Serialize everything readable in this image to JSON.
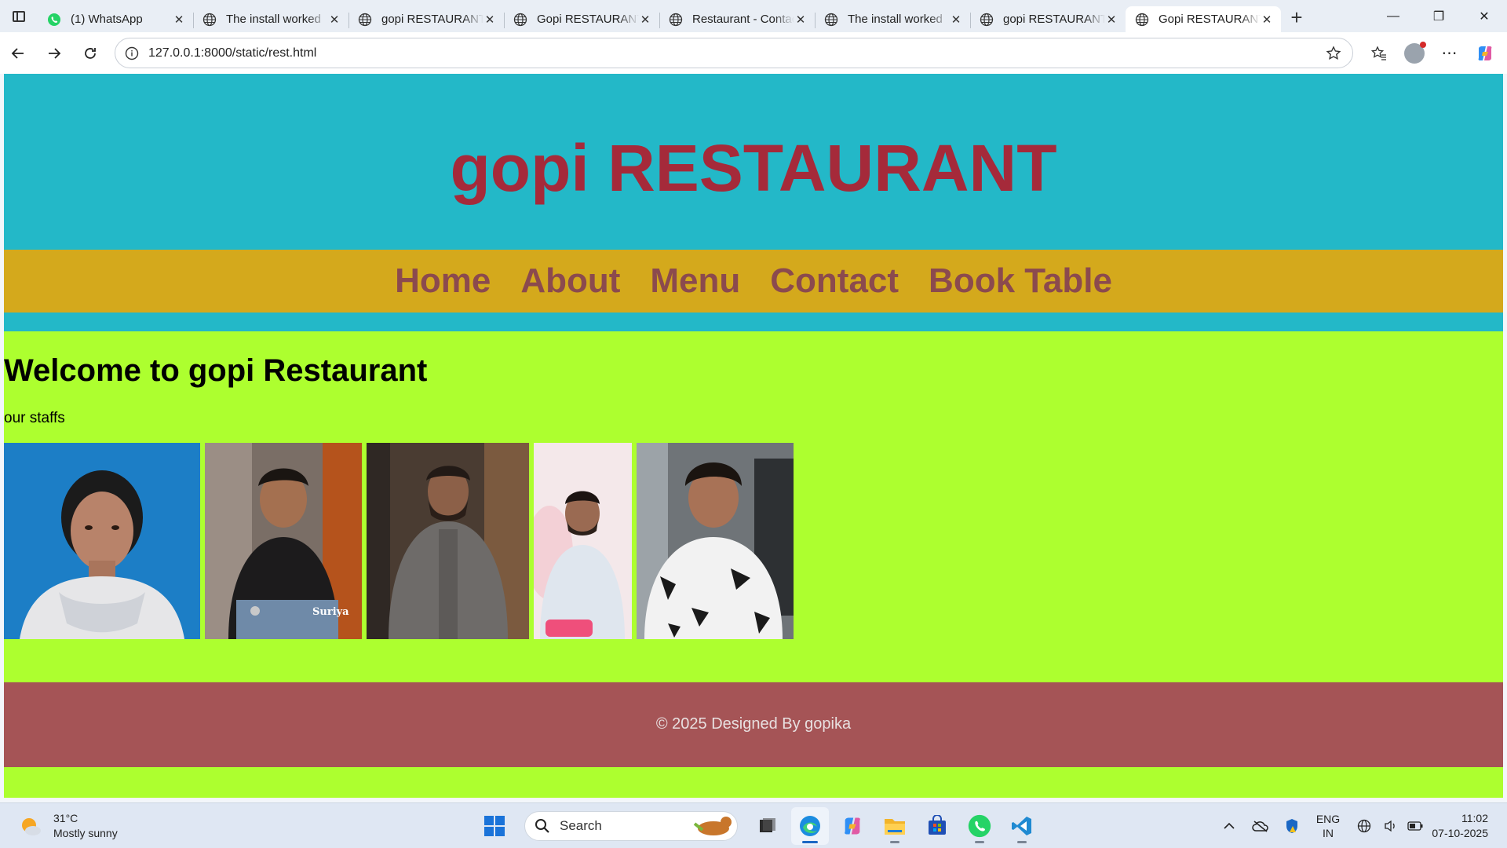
{
  "browser": {
    "tabs": [
      {
        "title": "(1) WhatsApp",
        "icon": "whatsapp-icon",
        "active": false
      },
      {
        "title": "The install worked",
        "icon": "globe-icon",
        "active": false
      },
      {
        "title": "gopi RESTAURANT",
        "icon": "globe-icon",
        "active": false
      },
      {
        "title": "Gopi RESTAURANT",
        "icon": "globe-icon",
        "active": false
      },
      {
        "title": "Restaurant - Contact",
        "icon": "globe-icon",
        "active": false
      },
      {
        "title": "The install worked",
        "icon": "globe-icon",
        "active": false
      },
      {
        "title": "gopi RESTAURANT",
        "icon": "globe-icon",
        "active": false
      },
      {
        "title": "Gopi RESTAURANT",
        "icon": "globe-icon",
        "active": true
      }
    ],
    "url": "127.0.0.1:8000/static/rest.html"
  },
  "site": {
    "title": "gopi RESTAURANT",
    "nav": [
      "Home",
      "About",
      "Menu",
      "Contact",
      "Book Table"
    ],
    "welcome": "Welcome to gopi Restaurant",
    "staff_label": "our staffs",
    "staff_photos": [
      {
        "label": "",
        "bg": "#1c7ec6"
      },
      {
        "label": "Suriya",
        "bg": "#3a3632"
      },
      {
        "label": "",
        "bg": "#4a3c32"
      },
      {
        "label": "",
        "bg": "#f4e8ea"
      },
      {
        "label": "",
        "bg": "#6f7478"
      }
    ],
    "footer": "© 2025 Designed By gopika"
  },
  "colors": {
    "header_bg": "#23b8c8",
    "title": "#a52a3a",
    "nav_bg": "#d4a91c",
    "nav_link": "#8b4a4e",
    "body_bg": "#adff2f",
    "footer_bg": "#a55456"
  },
  "taskbar": {
    "weather_temp": "31°C",
    "weather_desc": "Mostly sunny",
    "search_placeholder": "Search",
    "apps": [
      "file-explorer-icon",
      "edge-icon",
      "copilot-icon",
      "folder-icon",
      "store-icon",
      "whatsapp-icon",
      "vscode-icon"
    ],
    "lang_top": "ENG",
    "lang_bottom": "IN",
    "time": "11:02",
    "date": "07-10-2025"
  }
}
